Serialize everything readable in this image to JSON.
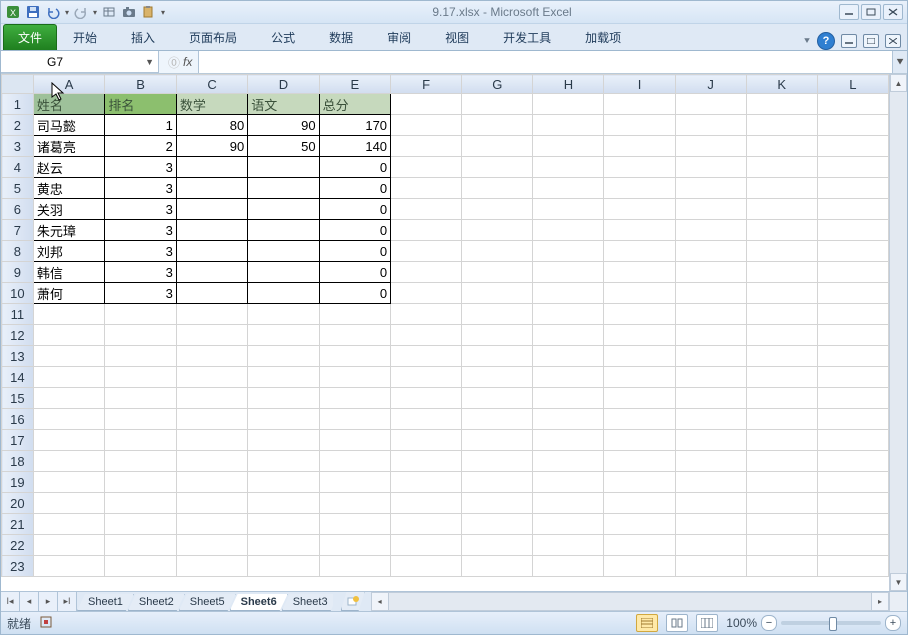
{
  "title": "9.17.xlsx - Microsoft Excel",
  "qat": [
    "excel-icon",
    "save-icon",
    "undo-icon",
    "redo-icon",
    "table-icon",
    "camera-icon",
    "paste-icon"
  ],
  "ribbon": {
    "file": "文件",
    "tabs": [
      "开始",
      "插入",
      "页面布局",
      "公式",
      "数据",
      "审阅",
      "视图",
      "开发工具",
      "加载项"
    ]
  },
  "namebox": "G7",
  "formula": "",
  "columns": [
    "A",
    "B",
    "C",
    "D",
    "E",
    "F",
    "G",
    "H",
    "I",
    "J",
    "K",
    "L"
  ],
  "row_count": 23,
  "headers": [
    "姓名",
    "排名",
    "数学",
    "语文",
    "总分"
  ],
  "data_rows": [
    {
      "name": "司马懿",
      "rank": "1",
      "math": "80",
      "chn": "90",
      "total": "170"
    },
    {
      "name": "诸葛亮",
      "rank": "2",
      "math": "90",
      "chn": "50",
      "total": "140"
    },
    {
      "name": "赵云",
      "rank": "3",
      "math": "",
      "chn": "",
      "total": "0"
    },
    {
      "name": "黄忠",
      "rank": "3",
      "math": "",
      "chn": "",
      "total": "0"
    },
    {
      "name": "关羽",
      "rank": "3",
      "math": "",
      "chn": "",
      "total": "0"
    },
    {
      "name": "朱元璋",
      "rank": "3",
      "math": "",
      "chn": "",
      "total": "0"
    },
    {
      "name": "刘邦",
      "rank": "3",
      "math": "",
      "chn": "",
      "total": "0"
    },
    {
      "name": "韩信",
      "rank": "3",
      "math": "",
      "chn": "",
      "total": "0"
    },
    {
      "name": "萧何",
      "rank": "3",
      "math": "",
      "chn": "",
      "total": "0"
    }
  ],
  "sheets": [
    "Sheet1",
    "Sheet2",
    "Sheet5",
    "Sheet6",
    "Sheet3"
  ],
  "active_sheet": 3,
  "status": {
    "ready": "就绪",
    "macro": "",
    "zoom": "100%"
  }
}
